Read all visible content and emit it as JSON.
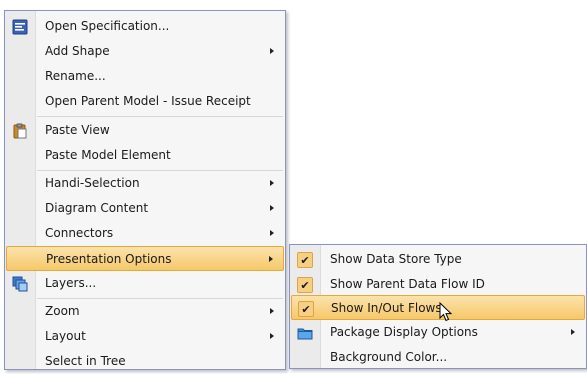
{
  "main_menu": {
    "items": [
      {
        "label": "Open Specification...",
        "icon": "specification-icon"
      },
      {
        "label": "Add Shape",
        "submenu": true
      },
      {
        "label": "Rename..."
      },
      {
        "label": "Open Parent Model - Issue Receipt"
      },
      {
        "label": "Paste View",
        "icon": "paste-icon"
      },
      {
        "label": "Paste Model Element"
      },
      {
        "label": "Handi-Selection",
        "submenu": true
      },
      {
        "label": "Diagram Content",
        "submenu": true
      },
      {
        "label": "Connectors",
        "submenu": true
      },
      {
        "label": "Presentation Options",
        "submenu": true,
        "highlighted": true
      },
      {
        "label": "Layers...",
        "icon": "layers-icon"
      },
      {
        "label": "Zoom",
        "submenu": true
      },
      {
        "label": "Layout",
        "submenu": true
      },
      {
        "label": "Select in Tree"
      }
    ]
  },
  "sub_menu": {
    "items": [
      {
        "label": "Show Data Store Type",
        "checked": true
      },
      {
        "label": "Show Parent Data Flow ID",
        "checked": true
      },
      {
        "label": "Show In/Out Flows",
        "checked": true,
        "highlighted": true
      },
      {
        "label": "Package Display Options",
        "icon": "folder-icon",
        "submenu": true
      },
      {
        "label": "Background Color..."
      }
    ]
  },
  "colors": {
    "highlight_top": "#fbe3ac",
    "highlight_bottom": "#f6c869",
    "menu_border": "#8a93c2",
    "menu_background": "#f6f6f6"
  }
}
